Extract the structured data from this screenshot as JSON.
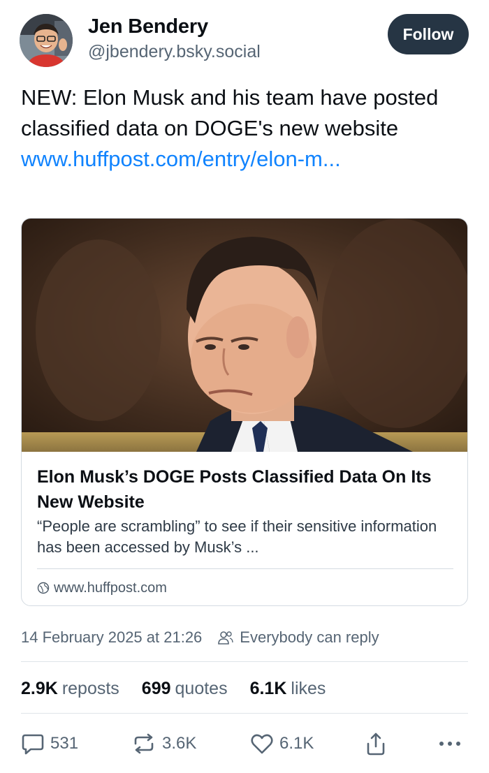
{
  "author": {
    "name": "Jen Bendery",
    "handle": "@jbendery.bsky.social",
    "follow_label": "Follow"
  },
  "post": {
    "text": "NEW: Elon Musk and his team have posted classified data on DOGE's new website ",
    "link_text": "www.huffpost.com/entry/elon-m..."
  },
  "link_card": {
    "title": "Elon Musk’s DOGE Posts Classified Data On Its New Website",
    "description": "“People are scrambling” to see if their sensitive information has been accessed by Musk’s ...",
    "domain": "www.huffpost.com"
  },
  "meta": {
    "timestamp": "14 February 2025 at 21:26",
    "reply_setting": "Everybody can reply"
  },
  "stats": {
    "reposts_count": "2.9K",
    "reposts_label": "reposts",
    "quotes_count": "699",
    "quotes_label": "quotes",
    "likes_count": "6.1K",
    "likes_label": "likes"
  },
  "actions": {
    "reply_count": "531",
    "repost_count": "3.6K",
    "like_count": "6.1K",
    "icons": [
      "reply-icon",
      "repost-icon",
      "like-icon",
      "share-icon",
      "more-icon"
    ]
  },
  "colors": {
    "link": "#1083fe",
    "follow_button": "#263544",
    "muted_text": "#566574"
  }
}
